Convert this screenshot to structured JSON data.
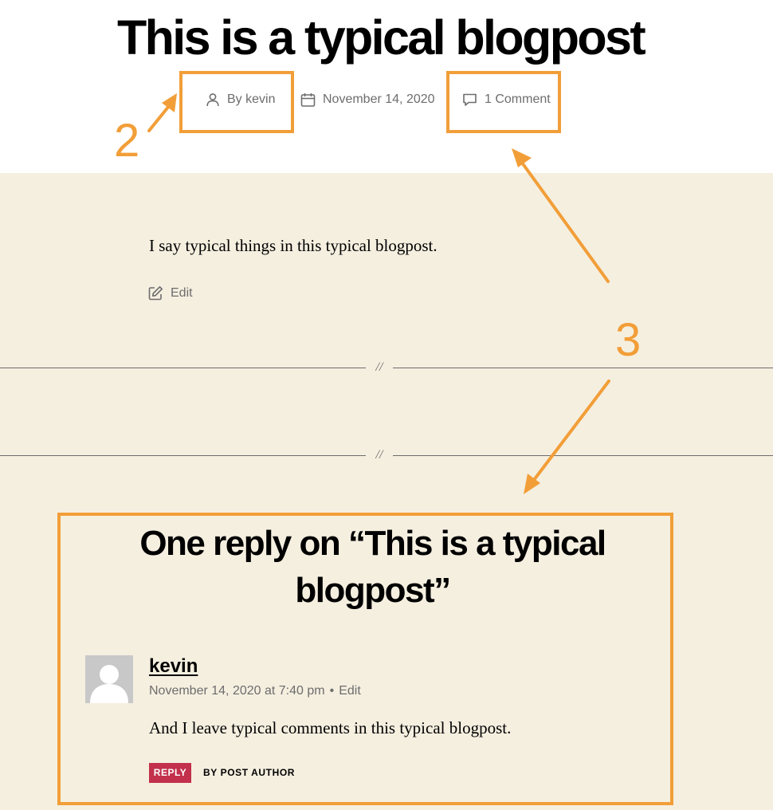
{
  "post": {
    "title": "This is a typical blogpost",
    "author_label": "By kevin",
    "date": "November 14, 2020",
    "comments_link": "1 Comment",
    "content": "I say typical things in this typical blogpost.",
    "edit_label": "Edit"
  },
  "separator": {
    "mark": "//"
  },
  "comments": {
    "title": "One reply on “This is a typical blogpost”",
    "items": [
      {
        "author": "kevin",
        "timestamp": "November 14, 2020 at 7:40 pm",
        "separator": "•",
        "edit_label": "Edit",
        "text": "And I leave typical comments in this typical blogpost.",
        "reply_label": "REPLY",
        "badge": "BY POST AUTHOR"
      }
    ]
  },
  "annotations": {
    "color": "#f29e38",
    "label_2": "2",
    "label_3": "3"
  },
  "colors": {
    "background": "#f5efe0",
    "header_background": "#ffffff",
    "meta_text": "#6d6d6d",
    "reply_button": "#c2304c"
  },
  "icons": {
    "author": "person-icon",
    "date": "calendar-icon",
    "comments": "speech-bubble-icon",
    "edit": "pencil-square-icon"
  }
}
